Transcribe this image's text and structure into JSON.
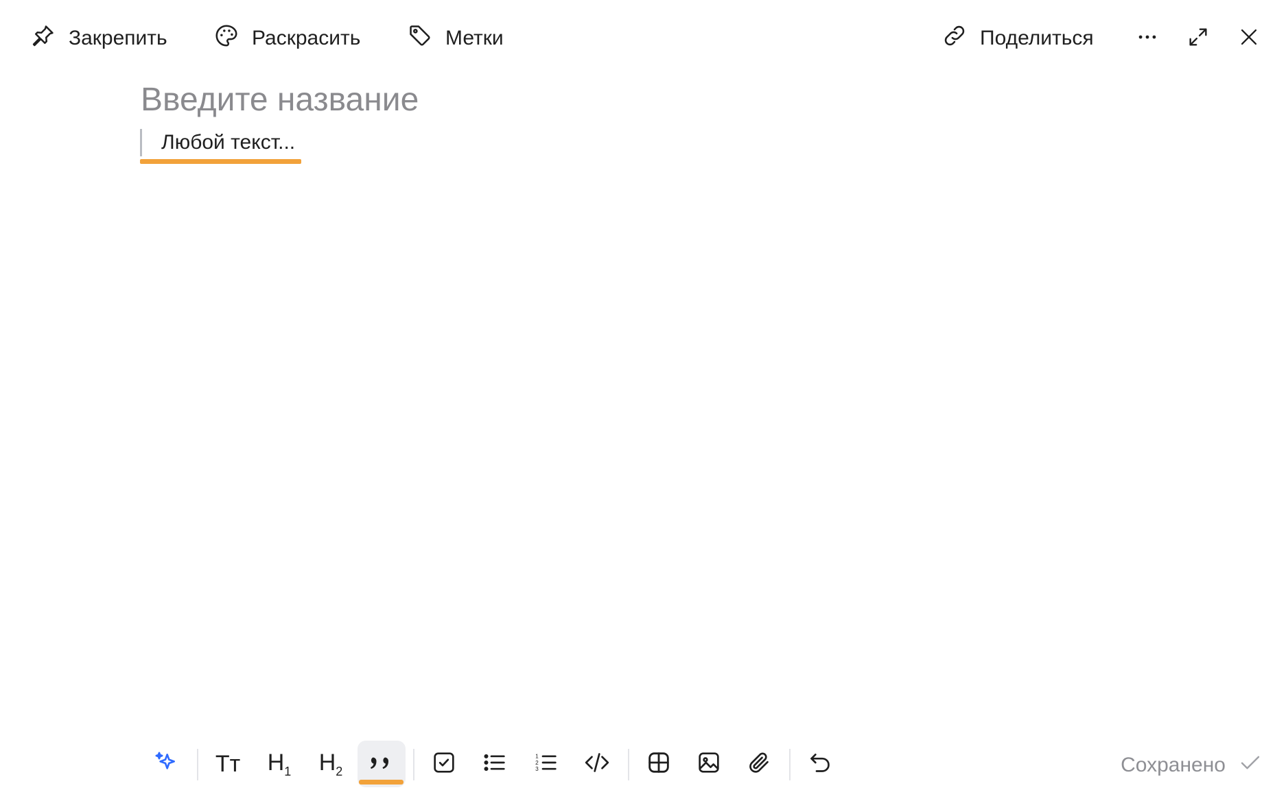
{
  "top_bar": {
    "pin_label": "Закрепить",
    "color_label": "Раскрасить",
    "tags_label": "Метки",
    "share_label": "Поделиться"
  },
  "editor": {
    "title_placeholder": "Введите название",
    "body_text": "Любой текст..."
  },
  "format_bar": {
    "text_style_label": "Tт",
    "h1_label": "H",
    "h1_sub": "1",
    "h2_label": "H",
    "h2_sub": "2",
    "active_tool": "quote"
  },
  "status": {
    "saved_label": "Сохранено"
  },
  "colors": {
    "accent": "#f2a23a",
    "ai_spark": "#2f6bff",
    "text": "#1f1f1f",
    "muted": "#8e8f94"
  }
}
